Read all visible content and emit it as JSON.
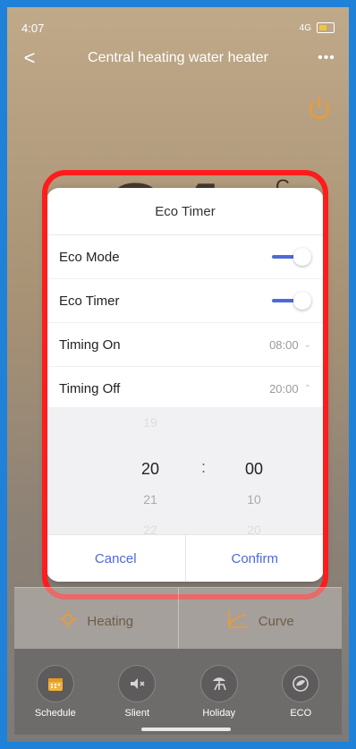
{
  "status_bar": {
    "time": "4:07",
    "signal": "4G"
  },
  "nav": {
    "back_label": "<",
    "title": "Central heating water heater",
    "more_label": "•••"
  },
  "background": {
    "temperature_partial": "24",
    "unit_partial": "C"
  },
  "modal": {
    "title": "Eco Timer",
    "rows": [
      {
        "label": "Eco Mode",
        "toggle_on": true
      },
      {
        "label": "Eco Timer",
        "toggle_on": true
      },
      {
        "label": "Timing On",
        "value": "08:00"
      },
      {
        "label": "Timing Off",
        "value": "20:00"
      }
    ],
    "picker": {
      "hours": [
        "19",
        "20",
        "21",
        "22"
      ],
      "minutes": [
        "00",
        "10",
        "20"
      ],
      "selected_hour": "20",
      "selected_minute": "00",
      "separator": ":"
    },
    "actions": {
      "cancel": "Cancel",
      "confirm": "Confirm"
    }
  },
  "modes": [
    {
      "label": "Heating",
      "icon": "sun-icon"
    },
    {
      "label": "Curve",
      "icon": "curve-icon"
    }
  ],
  "bottom_bar": [
    {
      "label": "Schedule",
      "icon": "calendar-icon"
    },
    {
      "label": "Slient",
      "icon": "mute-icon"
    },
    {
      "label": "Holiday",
      "icon": "beach-chair-icon"
    },
    {
      "label": "ECO",
      "icon": "eco-leaf-icon"
    }
  ],
  "colors": {
    "accent": "#4f69d8",
    "highlight": "#ff1c1c",
    "frame": "#1f82d8"
  }
}
